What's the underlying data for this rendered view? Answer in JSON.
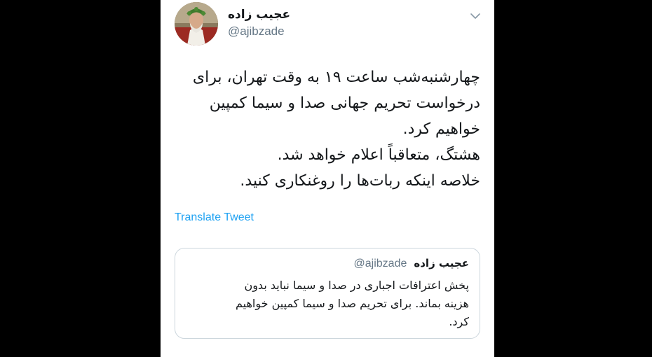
{
  "tweet": {
    "author": {
      "display_name": "عجیب زاده",
      "handle": "@ajibzade",
      "avatar_icon": "profile-photo-laurel-wreath"
    },
    "menu_icon": "chevron-down-icon",
    "text_lines": [
      "چهارشنبه‌شب ساعت ۱۹ به وقت تهران، برای",
      "درخواست تحریم جهانی صدا و سیما کمپین",
      "خواهیم کرد.",
      "هشتگ، متعاقباً اعلام خواهد شد.",
      "خلاصه اینکه ربات‌ها را روغنکاری کنید."
    ],
    "translate_label": "Translate Tweet"
  },
  "quoted_tweet": {
    "display_name": "عجیب زاده",
    "handle": "@ajibzade",
    "text_lines": [
      "پخش اعترافات اجباری در صدا و سیما نباید بدون",
      "هزینه بماند. برای تحریم صدا و سیما کمپین خواهیم",
      "کرد."
    ]
  },
  "colors": {
    "background": "#000000",
    "card": "#ffffff",
    "text": "#14171a",
    "secondary": "#657786",
    "link": "#1da1f2",
    "border": "#ccd6dd"
  }
}
